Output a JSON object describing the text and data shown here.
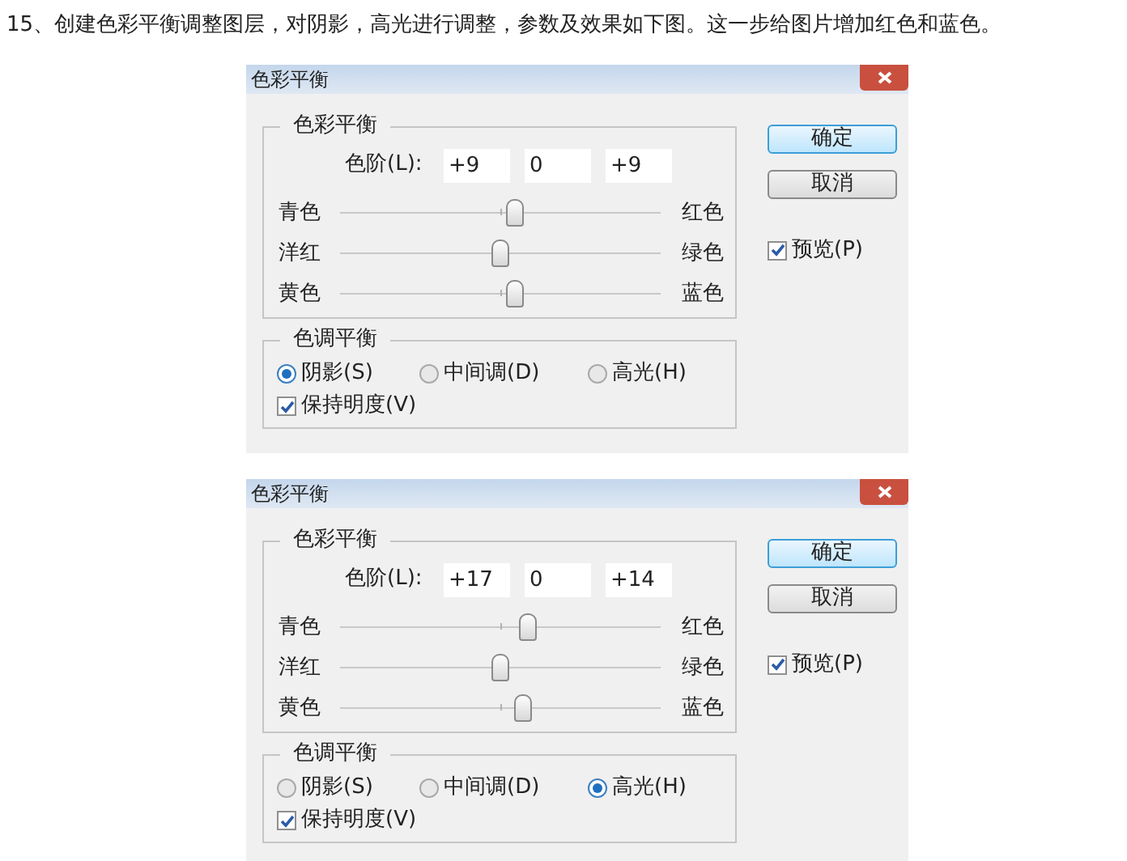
{
  "instruction": "15、创建色彩平衡调整图层，对阴影，高光进行调整，参数及效果如下图。这一步给图片增加红色和蓝色。",
  "dialogs": [
    {
      "title": "色彩平衡",
      "color_balance": {
        "legend": "色彩平衡",
        "levels_label": "色阶(L):",
        "levels": [
          "+9",
          "0",
          "+9"
        ],
        "sliders": [
          {
            "left": "青色",
            "right": "红色",
            "level": 0.545
          },
          {
            "left": "洋红",
            "right": "绿色",
            "level": 0.5
          },
          {
            "left": "黄色",
            "right": "蓝色",
            "level": 0.545
          }
        ]
      },
      "tone_balance": {
        "legend": "色调平衡",
        "options": [
          {
            "label": "阴影(S)",
            "selected": true
          },
          {
            "label": "中间调(D)",
            "selected": false
          },
          {
            "label": "高光(H)",
            "selected": false
          }
        ],
        "preserve": {
          "label": "保持明度(V)",
          "checked": true
        }
      },
      "buttons": [
        {
          "label": "确定",
          "default": true
        },
        {
          "label": "取消",
          "default": false
        }
      ],
      "preview": {
        "label": "预览(P)",
        "checked": true
      }
    },
    {
      "title": "色彩平衡",
      "color_balance": {
        "legend": "色彩平衡",
        "levels_label": "色阶(L):",
        "levels": [
          "+17",
          "0",
          "+14"
        ],
        "sliders": [
          {
            "left": "青色",
            "right": "红色",
            "level": 0.585
          },
          {
            "left": "洋红",
            "right": "绿色",
            "level": 0.5
          },
          {
            "left": "黄色",
            "right": "蓝色",
            "level": 0.57
          }
        ]
      },
      "tone_balance": {
        "legend": "色调平衡",
        "options": [
          {
            "label": "阴影(S)",
            "selected": false
          },
          {
            "label": "中间调(D)",
            "selected": false
          },
          {
            "label": "高光(H)",
            "selected": true
          }
        ],
        "preserve": {
          "label": "保持明度(V)",
          "checked": true
        }
      },
      "buttons": [
        {
          "label": "确定",
          "default": true
        },
        {
          "label": "取消",
          "default": false
        }
      ],
      "preview": {
        "label": "预览(P)",
        "checked": true
      }
    }
  ]
}
